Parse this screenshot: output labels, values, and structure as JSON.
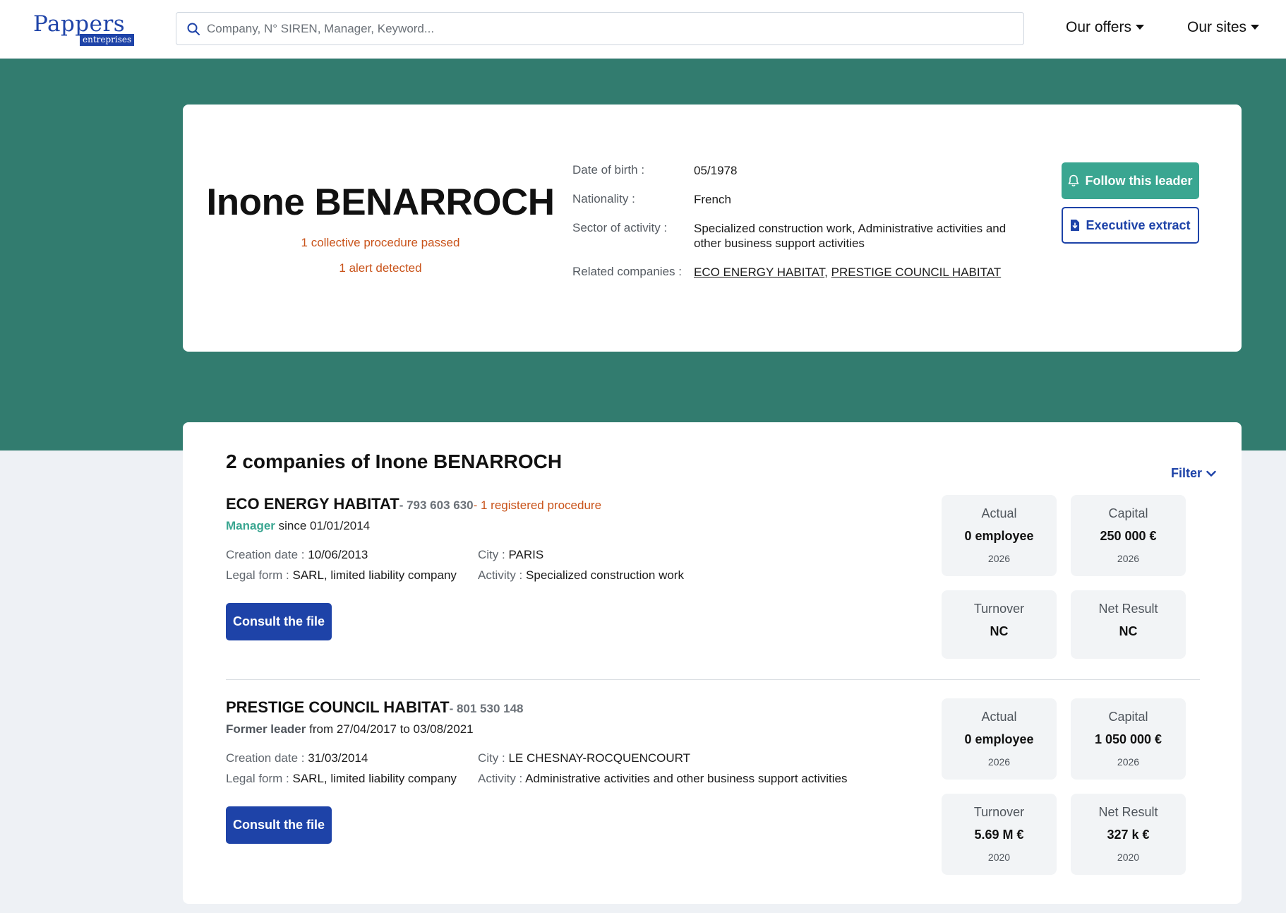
{
  "header": {
    "logo_main": "Pappers",
    "logo_sub": "entreprises",
    "search_placeholder": "Company, N° SIREN, Manager, Keyword...",
    "nav_offers": "Our offers",
    "nav_sites": "Our sites"
  },
  "profile": {
    "name": "Inone BENARROCH",
    "procedures": "1 collective procedure passed",
    "alerts": "1 alert detected",
    "dob_label": "Date of birth :",
    "dob_value": "05/1978",
    "nationality_label": "Nationality :",
    "nationality_value": "French",
    "sector_label": "Sector of activity :",
    "sector_value": "Specialized construction work, Administrative activities and other business support activities",
    "related_label": "Related companies :",
    "related_1": "ECO ENERGY HABITAT",
    "related_sep": ",",
    "related_2": "PRESTIGE COUNCIL HABITAT",
    "follow_button": "Follow this leader",
    "extract_button": "Executive extract"
  },
  "companies": {
    "title": "2 companies of Inone BENARROCH",
    "filter_label": "Filter",
    "items": [
      {
        "name": "ECO ENERGY HABITAT",
        "siren": "- 793 603 630",
        "procedure": "- 1 registered procedure",
        "role": "Manager",
        "role_detail": " since 01/01/2014",
        "creation_label": "Creation date :",
        "creation_value": " 10/06/2013",
        "legal_label": "Legal form :",
        "legal_value": " SARL, limited liability company",
        "city_label": "City :",
        "city_value": " PARIS",
        "activity_label": "Activity :",
        "activity_value": " Specialized construction work",
        "consult_button": "Consult the file",
        "stats": {
          "actual_label": "Actual",
          "actual_value": "0 employee",
          "actual_year": "2026",
          "capital_label": "Capital",
          "capital_value": "250 000 €",
          "capital_year": "2026",
          "turnover_label": "Turnover",
          "turnover_value": "NC",
          "net_label": "Net Result",
          "net_value": "NC"
        }
      },
      {
        "name": "PRESTIGE COUNCIL HABITAT",
        "siren": "- 801 530 148",
        "role": "Former leader",
        "role_detail": " from 27/04/2017 to 03/08/2021",
        "creation_label": "Creation date :",
        "creation_value": " 31/03/2014",
        "legal_label": "Legal form :",
        "legal_value": " SARL, limited liability company",
        "city_label": "City :",
        "city_value": " LE CHESNAY-ROCQUENCOURT",
        "activity_label": "Activity :",
        "activity_value": " Administrative activities and other business support activities",
        "consult_button": "Consult the file",
        "stats": {
          "actual_label": "Actual",
          "actual_value": "0 employee",
          "actual_year": "2026",
          "capital_label": "Capital",
          "capital_value": "1 050 000 €",
          "capital_year": "2026",
          "turnover_label": "Turnover",
          "turnover_value": "5.69 M €",
          "turnover_year": "2020",
          "net_label": "Net Result",
          "net_value": "327 k €",
          "net_year": "2020"
        }
      }
    ]
  },
  "colors": {
    "brand_blue": "#1e43a8",
    "band_green": "#327c6f",
    "accent_green": "#3aa691",
    "alert_orange": "#c9531a"
  },
  "icons": [
    "search-icon",
    "caret-down-icon",
    "bell-icon",
    "document-download-icon",
    "chevron-down-icon"
  ]
}
